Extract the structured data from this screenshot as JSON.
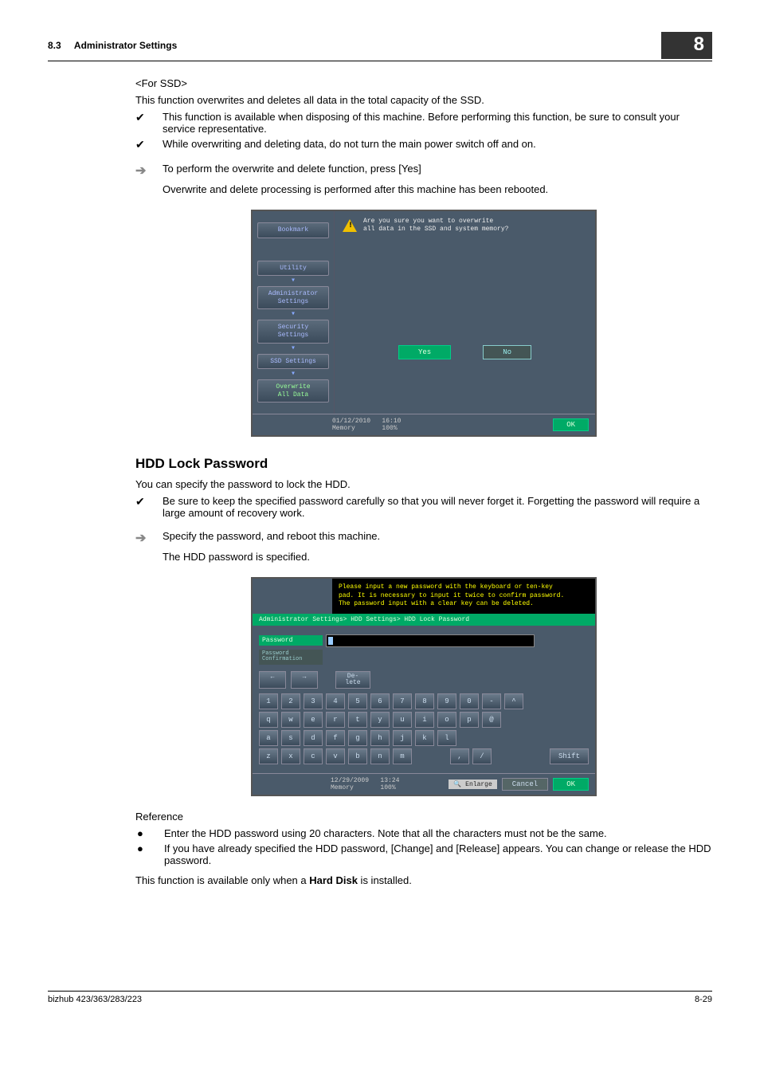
{
  "header": {
    "section_no": "8.3",
    "section_title": "Administrator Settings",
    "chapter": "8"
  },
  "intro": {
    "subhead": "<For SSD>",
    "desc": "This function overwrites and deletes all data in the total capacity of the SSD.",
    "b1": "This function is available when disposing of this machine. Before performing this function, be sure to consult your service representative.",
    "b2": "While overwriting and deleting data, do not turn the main power switch off and on.",
    "arrow1": "To perform the overwrite and delete function, press [Yes]",
    "arrow1_sub": "Overwrite and delete processing is performed after this machine has been rebooted."
  },
  "fig1": {
    "left": {
      "bookmark": "Bookmark",
      "utility": "Utility",
      "admin": "Administrator\nSettings",
      "security": "Security\nSettings",
      "ssd": "SSD Settings",
      "overwrite": "Overwrite\nAll Data"
    },
    "warn": "Are you sure you want to overwrite\nall data in the SSD and system memory?",
    "yes": "Yes",
    "no": "No",
    "date": "01/12/2010",
    "time": "16:10",
    "mem_label": "Memory",
    "mem_val": "100%",
    "ok": "OK"
  },
  "hdd": {
    "heading": "HDD Lock Password",
    "desc": "You can specify the password to lock the HDD.",
    "b1": "Be sure to keep the specified password carefully so that you will never forget it. Forgetting the password will require a large amount of recovery work.",
    "arrow1": "Specify the password, and reboot this machine.",
    "arrow1_sub": "The HDD password is specified."
  },
  "fig2": {
    "banner": "Please input a new password with the keyboard or ten-key\npad.  It is necessary to input it twice to confirm password.\nThe password input with a clear key can be deleted.",
    "breadcrumb": "Administrator Settings> HDD Settings> HDD Lock Password",
    "pw_label": "Password",
    "pwc_label": "Password\nConfirmation",
    "back": "←",
    "fwd": "→",
    "del": "De-\nlete",
    "rows": {
      "r1": [
        "1",
        "2",
        "3",
        "4",
        "5",
        "6",
        "7",
        "8",
        "9",
        "0",
        "-",
        "^"
      ],
      "r2": [
        "q",
        "w",
        "e",
        "r",
        "t",
        "y",
        "u",
        "i",
        "o",
        "p",
        "@"
      ],
      "r3": [
        "a",
        "s",
        "d",
        "f",
        "g",
        "h",
        "j",
        "k",
        "l"
      ],
      "r4": [
        "z",
        "x",
        "c",
        "v",
        "b",
        "n",
        "m"
      ],
      "r4b": [
        ",",
        "/"
      ]
    },
    "shift": "Shift",
    "date": "12/29/2009",
    "time": "13:24",
    "mem_label": "Memory",
    "mem_val": "100%",
    "enlarge": "Enlarge",
    "cancel": "Cancel",
    "ok": "OK"
  },
  "ref": {
    "heading": "Reference",
    "b1": "Enter the HDD password using 20 characters. Note that all the characters must not be the same.",
    "b2": "If you have already specified the HDD password, [Change] and [Release] appears. You can change or release the HDD password.",
    "final_pre": "This function is available only when a ",
    "final_bold": "Hard Disk",
    "final_post": " is installed."
  },
  "footer": {
    "left": "bizhub 423/363/283/223",
    "right": "8-29"
  }
}
